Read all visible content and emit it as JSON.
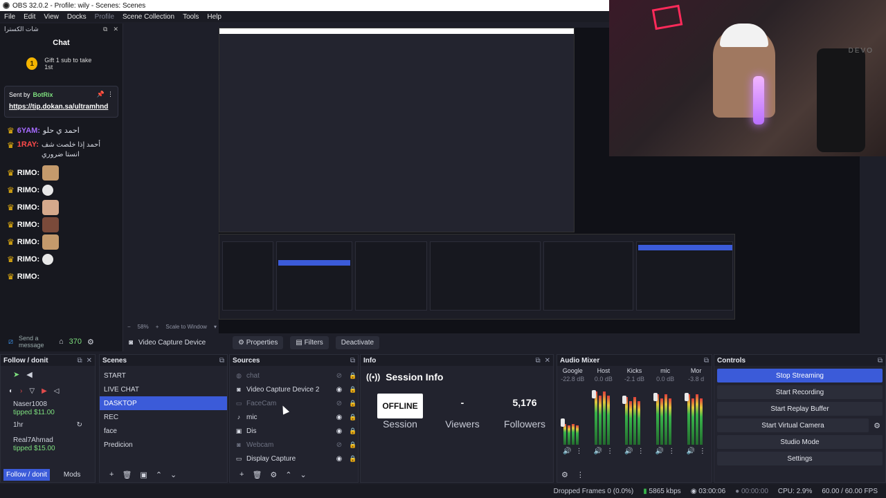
{
  "window": {
    "title": "OBS 32.0.2 - Profile: wily - Scenes: Scenes"
  },
  "menu": [
    "File",
    "Edit",
    "View",
    "Docks",
    "Profile",
    "Scene Collection",
    "Tools",
    "Help"
  ],
  "chat": {
    "header": "شات الكسترا",
    "title": "Chat",
    "gift": {
      "icon": "1",
      "text": "Gift 1 sub to take 1st"
    },
    "pinned": {
      "sent_by": "Sent by",
      "sender": "BotRix",
      "url": "https://tip.dokan.sa/ultramhnd"
    },
    "messages": [
      {
        "user": "6YAM:",
        "text": "احمد ي حلو"
      },
      {
        "user": "1RAY:",
        "text": "أحمد إذا خلصت شف انستا ضروري"
      },
      {
        "user": "RIMO:",
        "text": ""
      },
      {
        "user": "RIMO:",
        "text": ""
      },
      {
        "user": "RIMO:",
        "text": ""
      },
      {
        "user": "RIMO:",
        "text": ""
      },
      {
        "user": "RIMO:",
        "text": ""
      },
      {
        "user": "RIMO:",
        "text": ""
      },
      {
        "user": "RIMO:",
        "text": ""
      }
    ],
    "footer": {
      "send_placeholder": "Send a message",
      "points": "370"
    }
  },
  "preview": {
    "zoom": "58%",
    "scale_label": "Scale to Window"
  },
  "source_bar": {
    "source_name": "Video Capture Device",
    "properties": "Properties",
    "filters": "Filters",
    "deactivate": "Deactivate"
  },
  "docks": {
    "follow": {
      "title": "Follow / donit",
      "tips": [
        {
          "name": "Naser1008",
          "amount": "tipped $11.00",
          "time": "1hr"
        },
        {
          "name": "Real7Ahmad",
          "amount": "tipped $15.00"
        }
      ],
      "tabs": [
        "Follow / donit",
        "Mods"
      ]
    },
    "scenes": {
      "title": "Scenes",
      "items": [
        "START",
        "LIVE CHAT",
        "DASKTOP",
        "REC",
        "face",
        "Predicion"
      ],
      "selected": "DASKTOP"
    },
    "sources": {
      "title": "Sources",
      "items": [
        {
          "name": "chat",
          "icon": "browser-icon",
          "visible": false
        },
        {
          "name": "Video Capture Device 2",
          "icon": "camera-icon",
          "visible": true
        },
        {
          "name": "FaceCam",
          "icon": "image-icon",
          "visible": false
        },
        {
          "name": "mic",
          "icon": "mic-icon",
          "visible": true
        },
        {
          "name": "Dis",
          "icon": "capture-icon",
          "visible": true
        },
        {
          "name": "Webcam",
          "icon": "camera-icon",
          "visible": false
        },
        {
          "name": "Display Capture",
          "icon": "display-icon",
          "visible": true
        }
      ]
    },
    "info": {
      "title": "Info",
      "session_title": "Session Info",
      "status": "OFFLINE",
      "status_label": "Session",
      "viewers": "-",
      "viewers_label": "Viewers",
      "followers": "5,176",
      "followers_label": "Followers"
    },
    "mixer": {
      "title": "Audio Mixer",
      "channels": [
        {
          "name": "Google",
          "db": "-22.8 dB",
          "level": 0.35
        },
        {
          "name": "Host",
          "db": "0.0 dB",
          "level": 0.9
        },
        {
          "name": "Kicks",
          "db": "-2.1 dB",
          "level": 0.8
        },
        {
          "name": "mic",
          "db": "0.0 dB",
          "level": 0.85
        },
        {
          "name": "Mor",
          "db": "-3.8 d",
          "level": 0.85
        }
      ]
    },
    "controls": {
      "title": "Controls",
      "buttons": [
        "Stop Streaming",
        "Start Recording",
        "Start Replay Buffer",
        "Start Virtual Camera",
        "Studio Mode",
        "Settings"
      ]
    }
  },
  "status_bar": {
    "dropped": "Dropped Frames 0 (0.0%)",
    "bitrate": "5865 kbps",
    "stream_time": "03:00:06",
    "rec_time": "00:00:00",
    "cpu": "CPU: 2.9%",
    "fps": "60.00 / 60.00 FPS"
  },
  "colors": {
    "accent": "#3b5bd9",
    "bg": "#1e1f29",
    "meter_green": "#38b44a"
  }
}
